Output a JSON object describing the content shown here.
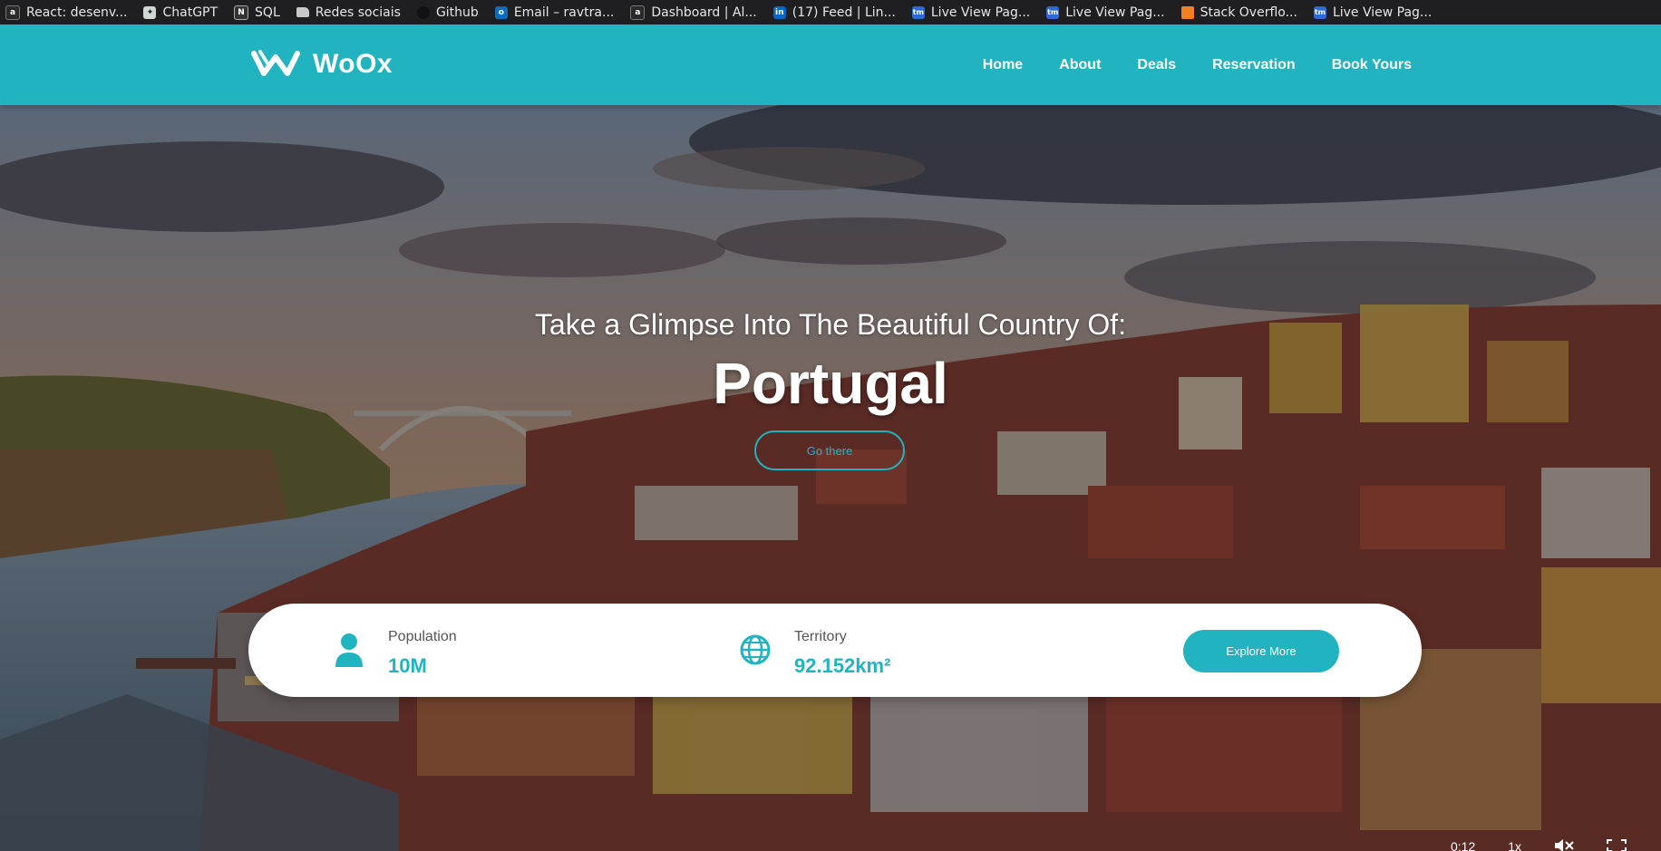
{
  "browser": {
    "bookmarks": [
      {
        "label": "React: desenv...",
        "icon": "a"
      },
      {
        "label": "ChatGPT",
        "icon": "gpt"
      },
      {
        "label": "SQL",
        "icon": "sql"
      },
      {
        "label": "Redes sociais",
        "icon": "folder"
      },
      {
        "label": "Github",
        "icon": "gh"
      },
      {
        "label": "Email – ravtra...",
        "icon": "ol"
      },
      {
        "label": "Dashboard | Al...",
        "icon": "a"
      },
      {
        "label": "(17) Feed | Lin...",
        "icon": "in"
      },
      {
        "label": "Live View Pag...",
        "icon": "tm"
      },
      {
        "label": "Live View Pag...",
        "icon": "tm"
      },
      {
        "label": "Stack Overflo...",
        "icon": "so"
      },
      {
        "label": "Live View Pag...",
        "icon": "tm"
      }
    ]
  },
  "header": {
    "logo_text": "WoOx",
    "nav": [
      "Home",
      "About",
      "Deals",
      "Reservation",
      "Book Yours"
    ]
  },
  "hero": {
    "subtitle": "Take a Glimpse Into The Beautiful Country Of:",
    "title": "Portugal",
    "cta_label": "Go there"
  },
  "info": {
    "population_label": "Population",
    "population_value": "10M",
    "territory_label": "Territory",
    "territory_value": "92.152km²",
    "explore_label": "Explore More"
  },
  "video": {
    "time": "0:12",
    "speed": "1x"
  },
  "colors": {
    "accent": "#22b3c1",
    "bookmark_bar": "#1f1f22"
  }
}
